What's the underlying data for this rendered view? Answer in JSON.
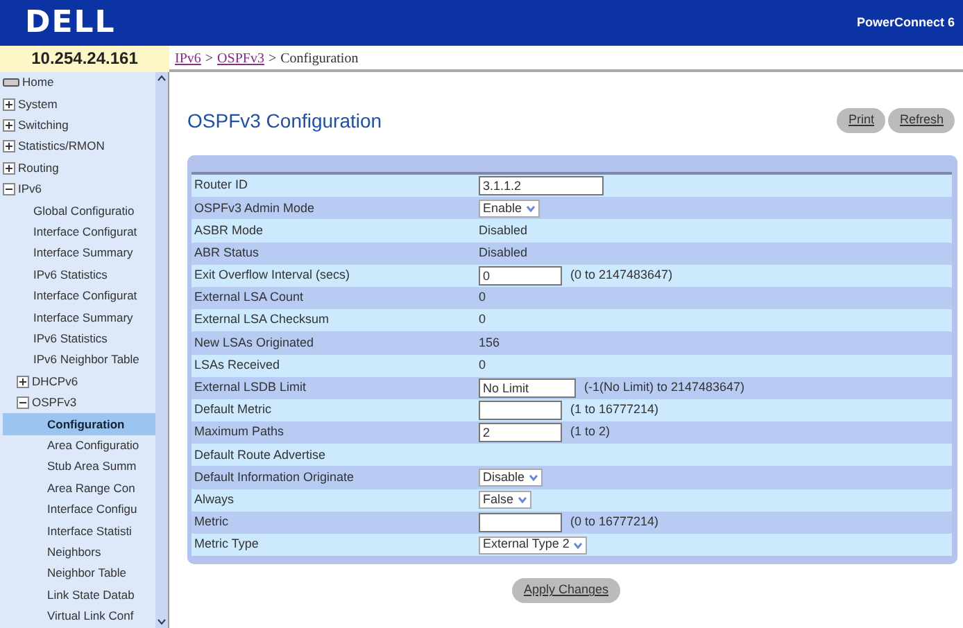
{
  "header": {
    "logo": "DELL",
    "product": "PowerConnect 6"
  },
  "address": "10.254.24.161",
  "breadcrumb_separator": ">",
  "breadcrumb": [
    {
      "text": "IPv6",
      "link": true
    },
    {
      "text": "OSPFv3",
      "link": true
    },
    {
      "text": "Configuration",
      "link": false
    }
  ],
  "sidebar": {
    "items": [
      {
        "label": "Home",
        "kind": "home"
      },
      {
        "label": "System",
        "kind": "folder",
        "expanded": false
      },
      {
        "label": "Switching",
        "kind": "folder",
        "expanded": false
      },
      {
        "label": "Statistics/RMON",
        "kind": "folder",
        "expanded": false
      },
      {
        "label": "Routing",
        "kind": "folder",
        "expanded": false
      },
      {
        "label": "IPv6",
        "kind": "folder",
        "expanded": true,
        "children": [
          {
            "label": "Global Configuratio",
            "kind": "page",
            "selected": false
          },
          {
            "label": "Interface Configurat",
            "kind": "page",
            "selected": false
          },
          {
            "label": "Interface Summary",
            "kind": "page",
            "selected": false
          },
          {
            "label": "IPv6 Statistics",
            "kind": "page",
            "selected": false
          },
          {
            "label": "Interface Configurat",
            "kind": "page",
            "selected": false
          },
          {
            "label": "Interface Summary",
            "kind": "page",
            "selected": false
          },
          {
            "label": "IPv6 Statistics",
            "kind": "page",
            "selected": false
          },
          {
            "label": "IPv6 Neighbor Table",
            "kind": "page",
            "selected": false
          },
          {
            "label": "DHCPv6",
            "kind": "folder",
            "expanded": false
          },
          {
            "label": "OSPFv3",
            "kind": "folder",
            "expanded": true,
            "children": [
              {
                "label": "Configuration",
                "kind": "page",
                "selected": true
              },
              {
                "label": "Area Configuratio",
                "kind": "page",
                "selected": false
              },
              {
                "label": "Stub Area Summ",
                "kind": "page",
                "selected": false
              },
              {
                "label": "Area Range Con",
                "kind": "page",
                "selected": false
              },
              {
                "label": "Interface Configu",
                "kind": "page",
                "selected": false
              },
              {
                "label": "Interface Statisti",
                "kind": "page",
                "selected": false
              },
              {
                "label": "Neighbors",
                "kind": "page",
                "selected": false
              },
              {
                "label": "Neighbor Table",
                "kind": "page",
                "selected": false
              },
              {
                "label": "Link State Datab",
                "kind": "page",
                "selected": false
              },
              {
                "label": "Virtual Link Conf",
                "kind": "page",
                "selected": false
              }
            ]
          }
        ]
      }
    ]
  },
  "page": {
    "title": "OSPFv3 Configuration",
    "buttons": [
      "Print",
      "Refresh"
    ]
  },
  "form": {
    "rows": [
      {
        "label": "Router ID",
        "kind": "input",
        "value": "3.1.1.2"
      },
      {
        "label": "OSPFv3 Admin Mode",
        "kind": "select",
        "value": "Enable"
      },
      {
        "label": "ASBR Mode",
        "kind": "text",
        "value": "Disabled"
      },
      {
        "label": "ABR Status",
        "kind": "text",
        "value": "Disabled"
      },
      {
        "label": "Exit Overflow Interval (secs)",
        "kind": "input",
        "value": "0",
        "hint": "(0 to 2147483647)"
      },
      {
        "label": "External LSA Count",
        "kind": "text",
        "value": "0"
      },
      {
        "label": "External LSA Checksum",
        "kind": "text",
        "value": "0"
      },
      {
        "label": "New LSAs Originated",
        "kind": "text",
        "value": "156"
      },
      {
        "label": "LSAs Received",
        "kind": "text",
        "value": "0"
      },
      {
        "label": "External LSDB Limit",
        "kind": "input",
        "value": "No Limit",
        "hint": "(-1(No Limit) to 2147483647)"
      },
      {
        "label": "Default Metric",
        "kind": "input",
        "hint": "(1 to 16777214)"
      },
      {
        "label": "Maximum Paths",
        "kind": "input",
        "value": "2",
        "hint": "(1 to 2)"
      },
      {
        "label": "Default Route Advertise",
        "kind": "blank"
      },
      {
        "label": "Default Information Originate",
        "kind": "select",
        "value": "Disable"
      },
      {
        "label": "Always",
        "kind": "select",
        "value": "False"
      },
      {
        "label": "Metric",
        "kind": "input",
        "hint": "(0 to 16777214)"
      },
      {
        "label": "Metric Type",
        "kind": "select",
        "value": "External Type 2"
      }
    ]
  },
  "apply_button": "Apply Changes"
}
